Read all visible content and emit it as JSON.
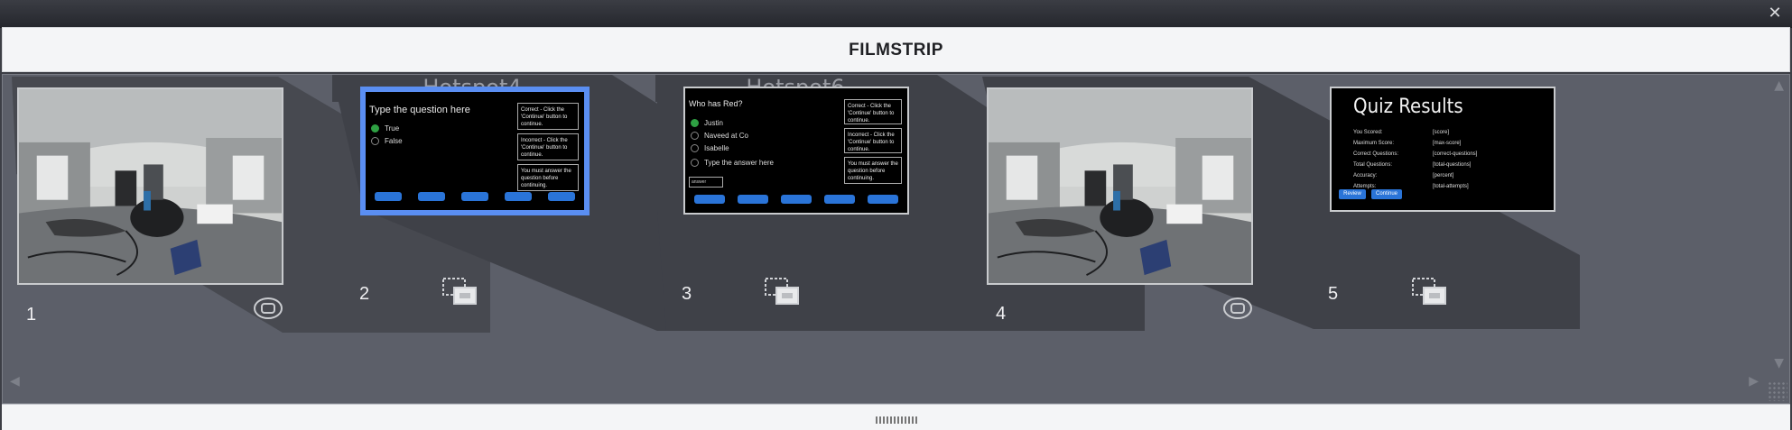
{
  "window": {
    "title": "FILMSTRIP",
    "close_glyph": "✕"
  },
  "groups": [
    {
      "label": "Hotspot4"
    },
    {
      "label": "Hotspot6"
    }
  ],
  "slides": [
    {
      "number": "1",
      "kind": "360-image",
      "icon": "360-icon"
    },
    {
      "number": "2",
      "kind": "quiz",
      "icon": "multi-slide-icon",
      "selected": true,
      "question": "Type the question here",
      "options": [
        "True",
        "False"
      ],
      "feedback": [
        "Correct - Click the 'Continue' button to continue.",
        "Incorrect - Click the 'Continue' button to continue.",
        "You must answer the question before continuing."
      ],
      "buttons": [
        "",
        "",
        "",
        "",
        ""
      ]
    },
    {
      "number": "3",
      "kind": "quiz",
      "icon": "multi-slide-icon",
      "question": "Who has Red?",
      "options": [
        "Justin",
        "Naveed at Co",
        "Isabelle",
        "Type the answer here"
      ],
      "answer_placeholder": "answer",
      "feedback": [
        "Correct - Click the 'Continue' button to continue.",
        "Incorrect - Click the 'Continue' button to continue.",
        "You must answer the question before continuing."
      ],
      "buttons": [
        "",
        "",
        "",
        "",
        ""
      ]
    },
    {
      "number": "4",
      "kind": "360-image",
      "icon": "360-icon"
    },
    {
      "number": "5",
      "kind": "quiz-results",
      "icon": "multi-slide-icon",
      "title": "Quiz Results",
      "rows": [
        {
          "label": "You Scored:",
          "value": "[score]"
        },
        {
          "label": "Maximum Score:",
          "value": "[max-score]"
        },
        {
          "label": "Correct Questions:",
          "value": "[correct-questions]"
        },
        {
          "label": "Total Questions:",
          "value": "[total-questions]"
        },
        {
          "label": "Accuracy:",
          "value": "[percent]"
        },
        {
          "label": "Attempts:",
          "value": "[total-attempts]"
        }
      ],
      "buttons": [
        "Review",
        "Continue"
      ]
    }
  ],
  "colors": {
    "accent": "#5a8ef2",
    "strip_bg": "#5c5f69",
    "shadow": "#3f4148",
    "button": "#2a74d8"
  }
}
